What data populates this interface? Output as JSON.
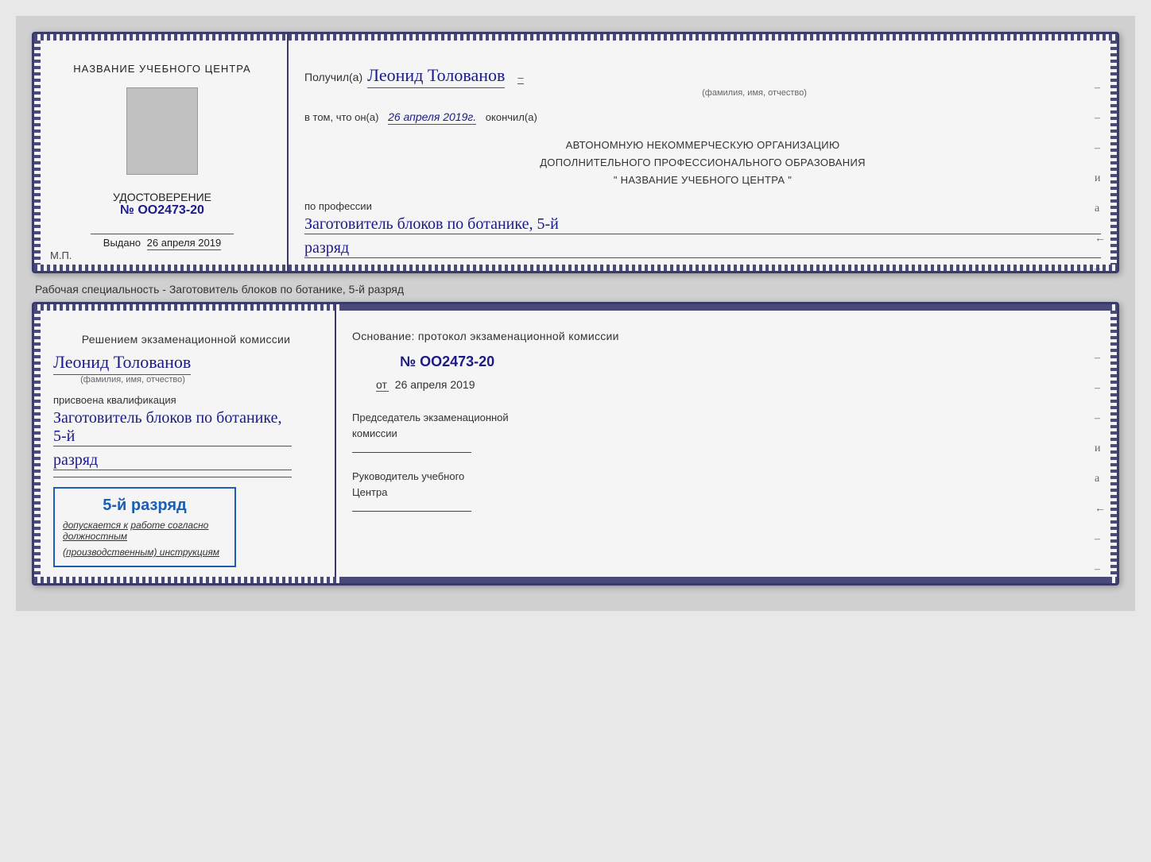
{
  "doc1": {
    "left": {
      "title": "НАЗВАНИЕ УЧЕБНОГО ЦЕНТРА",
      "cert_label": "УДОСТОВЕРЕНИЕ",
      "cert_number_prefix": "№",
      "cert_number": "OO2473-20",
      "issued_prefix": "Выдано",
      "issued_date": "26 апреля 2019",
      "mp_label": "М.П."
    },
    "right": {
      "recipient_prefix": "Получил(а)",
      "recipient_name": "Леонид Толованов",
      "recipient_sublabel": "(фамилия, имя, отчество)",
      "confirmed_prefix": "в том, что он(а)",
      "confirmed_date": "26 апреля 2019г.",
      "confirmed_suffix": "окончил(а)",
      "org_line1": "АВТОНОМНУЮ НЕКОММЕРЧЕСКУЮ ОРГАНИЗАЦИЮ",
      "org_line2": "ДОПОЛНИТЕЛЬНОГО ПРОФЕССИОНАЛЬНОГО ОБРАЗОВАНИЯ",
      "org_line3": "\"   НАЗВАНИЕ УЧЕБНОГО ЦЕНТРА   \"",
      "profession_label": "по профессии",
      "profession_value": "Заготовитель блоков по ботанике, 5-й",
      "razryad_value": "разряд"
    }
  },
  "between": {
    "text": "Рабочая специальность - Заготовитель блоков по ботанике, 5-й разряд"
  },
  "doc2": {
    "left": {
      "decision_text": "Решением экзаменационной комиссии",
      "recipient_name": "Леонид Толованов",
      "recipient_sublabel": "(фамилия, имя, отчество)",
      "qualification_label": "присвоена квалификация",
      "qualification_value": "Заготовитель блоков по ботанике, 5-й",
      "razryad_value": "разряд",
      "stamp_rank": "5-й разряд",
      "stamp_prefix": "допускается к",
      "stamp_text": "работе согласно должностным",
      "stamp_text2": "(производственным) инструкциям"
    },
    "right": {
      "basis_label": "Основание: протокол экзаменационной комиссии",
      "protocol_prefix": "№",
      "protocol_number": "OO2473-20",
      "date_prefix": "от",
      "date_value": "26 апреля 2019",
      "chair_label1": "Председатель экзаменационной",
      "chair_label2": "комиссии",
      "head_label1": "Руководитель учебного",
      "head_label2": "Центра"
    }
  },
  "dashes": [
    "–",
    "–",
    "–",
    "и",
    "а",
    "←",
    "–",
    "–",
    "–",
    "–"
  ],
  "dashes2": [
    "–",
    "–",
    "–",
    "–",
    "и",
    "а",
    "←",
    "–",
    "–",
    "–",
    "–"
  ]
}
